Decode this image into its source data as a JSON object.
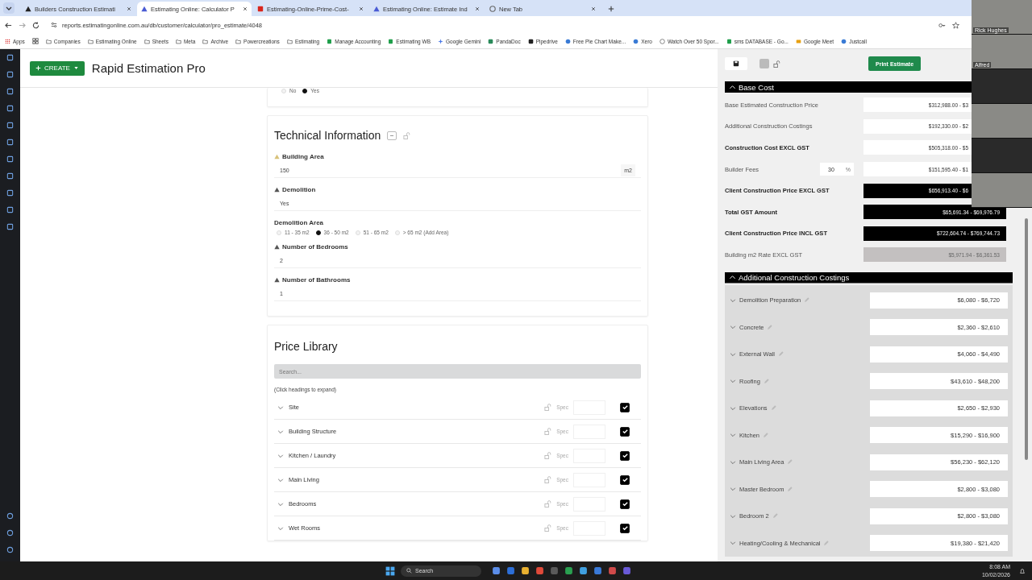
{
  "browser": {
    "tabs": [
      {
        "label": "Builders Construction Estimati",
        "kind": "dark",
        "selected": false
      },
      {
        "label": "Estimating Online: Calculator P",
        "kind": "site",
        "selected": true
      },
      {
        "label": "Estimating-Online-Prime-Cost-",
        "kind": "pdf",
        "selected": false
      },
      {
        "label": "Estimating Online: Estimate Ind",
        "kind": "site",
        "selected": false
      },
      {
        "label": "New Tab",
        "kind": "blank",
        "selected": false
      }
    ],
    "url": "reports.estimatingonline.com.au/db/customer/calculator/pro_estimate/4048",
    "bookmarks": [
      {
        "label": "Apps",
        "kind": "apps"
      },
      {
        "label": "Companies",
        "kind": "folder"
      },
      {
        "label": "Estimating Online",
        "kind": "folder"
      },
      {
        "label": "Sheets",
        "kind": "folder"
      },
      {
        "label": "Meta",
        "kind": "folder"
      },
      {
        "label": "Archive",
        "kind": "folder"
      },
      {
        "label": "Powercreations",
        "kind": "folder"
      },
      {
        "label": "Estimating",
        "kind": "folder"
      },
      {
        "label": "Manage Accounting",
        "kind": "sheet"
      },
      {
        "label": "Estimating WB",
        "kind": "sheet"
      },
      {
        "label": "Google Gemini",
        "kind": "spark"
      },
      {
        "label": "PandaDoc",
        "kind": "doc"
      },
      {
        "label": "Pipedrive",
        "kind": "badge"
      },
      {
        "label": "Free Pie Chart Make...",
        "kind": "circle"
      },
      {
        "label": "Xero",
        "kind": "circle"
      },
      {
        "label": "Watch Over 50 Spor...",
        "kind": "globe"
      },
      {
        "label": "sms DATABASE - Go...",
        "kind": "sheet"
      },
      {
        "label": "Google Meet",
        "kind": "meet"
      },
      {
        "label": "Justcall",
        "kind": "circle"
      }
    ]
  },
  "header": {
    "create_button": "CREATE",
    "title": "Rapid Estimation Pro"
  },
  "top_radio": [
    {
      "label": "No",
      "selected": false
    },
    {
      "label": "Yes",
      "selected": true
    }
  ],
  "technical": {
    "title": "Technical Information",
    "fields": [
      {
        "label": "Building Area",
        "kind": "input",
        "warning": true,
        "value": "150",
        "unit": "m2"
      },
      {
        "label": "Demolition",
        "kind": "input",
        "warning": false,
        "value": "Yes"
      },
      {
        "label": "Demolition Area",
        "kind": "radio",
        "options": [
          {
            "label": "11 - 35 m2",
            "selected": false
          },
          {
            "label": "36 - 50 m2",
            "selected": true
          },
          {
            "label": "51 - 65 m2",
            "selected": false
          },
          {
            "label": "> 65 m2 (Add Area)",
            "selected": false
          }
        ]
      },
      {
        "label": "Number of Bedrooms",
        "kind": "input",
        "warning": false,
        "value": "2"
      },
      {
        "label": "Number of Bathrooms",
        "kind": "input",
        "warning": false,
        "value": "1"
      }
    ]
  },
  "price_library": {
    "title": "Price Library",
    "search": {
      "placeholder": "Search..."
    },
    "hint": "(Click headings to expand)",
    "rows": [
      {
        "label": "Site",
        "spec": "Spec",
        "checked": true
      },
      {
        "label": "Building Structure",
        "spec": "Spec",
        "checked": true
      },
      {
        "label": "Kitchen / Laundry",
        "spec": "Spec",
        "checked": true
      },
      {
        "label": "Main Living",
        "spec": "Spec",
        "checked": true
      },
      {
        "label": "Bedrooms",
        "spec": "Spec",
        "checked": true
      },
      {
        "label": "Wet Rooms",
        "spec": "Spec",
        "checked": true
      }
    ]
  },
  "panel": {
    "print_button": "Print Estimate",
    "base_cost": {
      "title": "Base Cost",
      "rows": [
        {
          "label": "Base Estimated Construction Price",
          "kind": "white",
          "bold": false,
          "value": "$312,988.00 - $3"
        },
        {
          "label": "Additional Construction Costings",
          "kind": "white",
          "bold": false,
          "value": "$192,330.00 - $2"
        },
        {
          "label": "Construction Cost EXCL GST",
          "kind": "white",
          "bold": true,
          "value": "$505,318.00 - $5"
        },
        {
          "label": "Builder Fees",
          "kind": "white",
          "bold": false,
          "fee": "30",
          "fee_unit": "%",
          "value": "$151,595.40 - $1"
        },
        {
          "label": "Client Construction Price EXCL GST",
          "kind": "black",
          "bold": true,
          "value": "$656,913.40 - $6"
        },
        {
          "label": "Total GST Amount",
          "kind": "black",
          "bold": true,
          "value": "$65,691.34 - $69,976.79"
        },
        {
          "label": "Client Construction Price INCL GST",
          "kind": "black",
          "bold": true,
          "value": "$722,604.74 - $769,744.73"
        },
        {
          "label": "Building m2 Rate EXCL GST",
          "kind": "grey",
          "bold": false,
          "value": "$5,971.94 - $6,361.53"
        }
      ]
    },
    "additional": {
      "title": "Additional Construction Costings",
      "rows": [
        {
          "label": "Demolition Preparation",
          "value": "$6,080 - $6,720"
        },
        {
          "label": "Concrete",
          "value": "$2,360 - $2,610"
        },
        {
          "label": "External Wall",
          "value": "$4,060 - $4,490"
        },
        {
          "label": "Roofing",
          "value": "$43,610 - $48,200"
        },
        {
          "label": "Elevations",
          "value": "$2,650 - $2,930"
        },
        {
          "label": "Kitchen",
          "value": "$15,290 - $16,900"
        },
        {
          "label": "Main Living Area",
          "value": "$56,230 - $62,120"
        },
        {
          "label": "Master Bedroom",
          "value": "$2,800 - $3,080"
        },
        {
          "label": "Bedroom 2",
          "value": "$2,800 - $3,080"
        },
        {
          "label": "Heating/Cooling & Mechanical",
          "value": "$19,380 - $21,420"
        }
      ]
    }
  },
  "video_tiles": [
    {
      "kind": "camera",
      "name": "Rick Hughes"
    },
    {
      "kind": "camera",
      "name": "Alfred"
    },
    {
      "kind": "notetaker"
    },
    {
      "kind": "camera"
    },
    {
      "kind": "notetaker"
    },
    {
      "kind": "camera"
    }
  ],
  "taskbar": {
    "search": {
      "placeholder": "Search"
    },
    "time": "8:08 AM",
    "date": "10/02/2026"
  }
}
